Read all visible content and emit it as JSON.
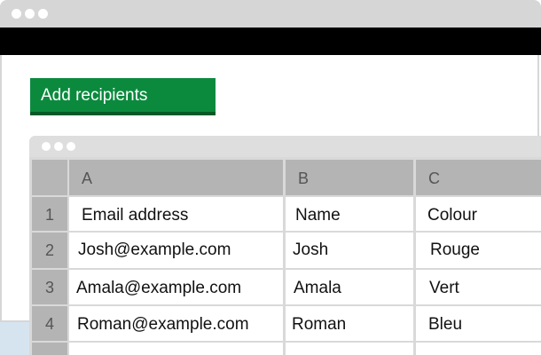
{
  "app": {
    "add_recipients_label": "Add recipients"
  },
  "colors": {
    "button_green": "#0b8a3e",
    "toolbar_black": "#000000",
    "titlebar_gray": "#d6d6d6"
  },
  "spreadsheet": {
    "columns": [
      "A",
      "B",
      "C"
    ],
    "rows": [
      {
        "row_number": "1",
        "cells": [
          "Email address",
          "Name",
          "Colour"
        ]
      },
      {
        "row_number": "2",
        "cells": [
          "Josh@example.com",
          "Josh",
          "Rouge"
        ]
      },
      {
        "row_number": "3",
        "cells": [
          "Amala@example.com",
          "Amala",
          "Vert"
        ]
      },
      {
        "row_number": "4",
        "cells": [
          "Roman@example.com",
          "Roman",
          "Bleu"
        ]
      }
    ]
  }
}
